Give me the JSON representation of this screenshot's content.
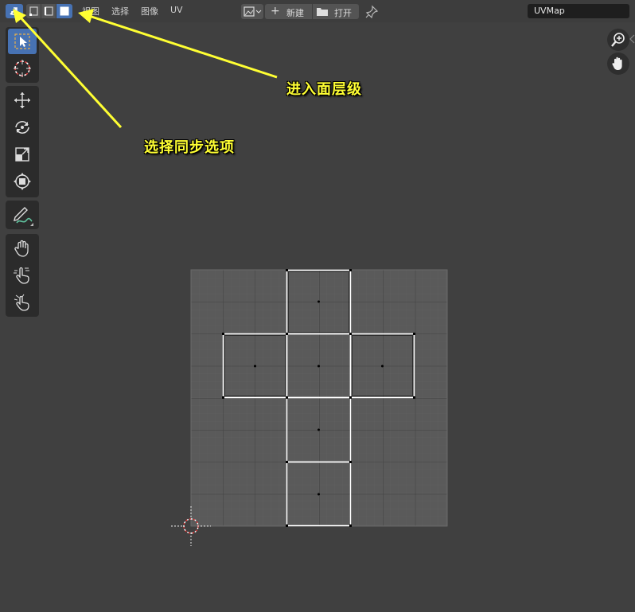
{
  "header": {
    "menus": [
      "视图",
      "选择",
      "图像",
      "UV"
    ],
    "new_label": "新建",
    "open_label": "打开",
    "uv_map_name": "UVMap"
  },
  "annotations": {
    "face_level": "进入面层级",
    "sync_option": "选择同步选项",
    "arrow_color": "#ffff33"
  },
  "toolbar": {
    "groups": [
      [
        "select-box",
        "cursor"
      ],
      [
        "move",
        "rotate",
        "scale",
        "transform"
      ],
      [
        "annotate"
      ],
      [
        "grab",
        "relax",
        "pinch"
      ]
    ]
  },
  "colors": {
    "background": "#404040",
    "active": "#4772b3",
    "uv_edge": "#ffffff",
    "grid": "#5a5a5a"
  }
}
